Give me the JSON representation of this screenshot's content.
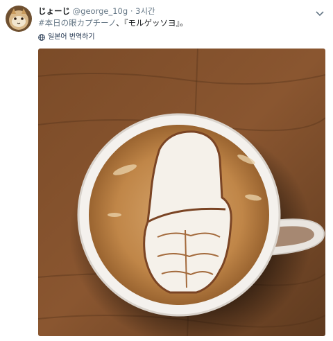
{
  "tweet": {
    "display_name": "じょーじ",
    "handle": "@george_10g",
    "separator": "·",
    "time": "3시간",
    "hashtag": "#本日の眼カプチーノ",
    "text_rest": "、『モルゲッソヨ』。",
    "translate_label": "일본어 번역하기"
  },
  "icons": {
    "avatar": "avatar-cat-photo",
    "caret": "chevron-down-icon",
    "translate": "globe-icon"
  },
  "colors": {
    "secondary_text": "#657786",
    "table_wood": "#7a4a28",
    "cup": "#f3f0ec",
    "crema": "#b47a3f"
  }
}
